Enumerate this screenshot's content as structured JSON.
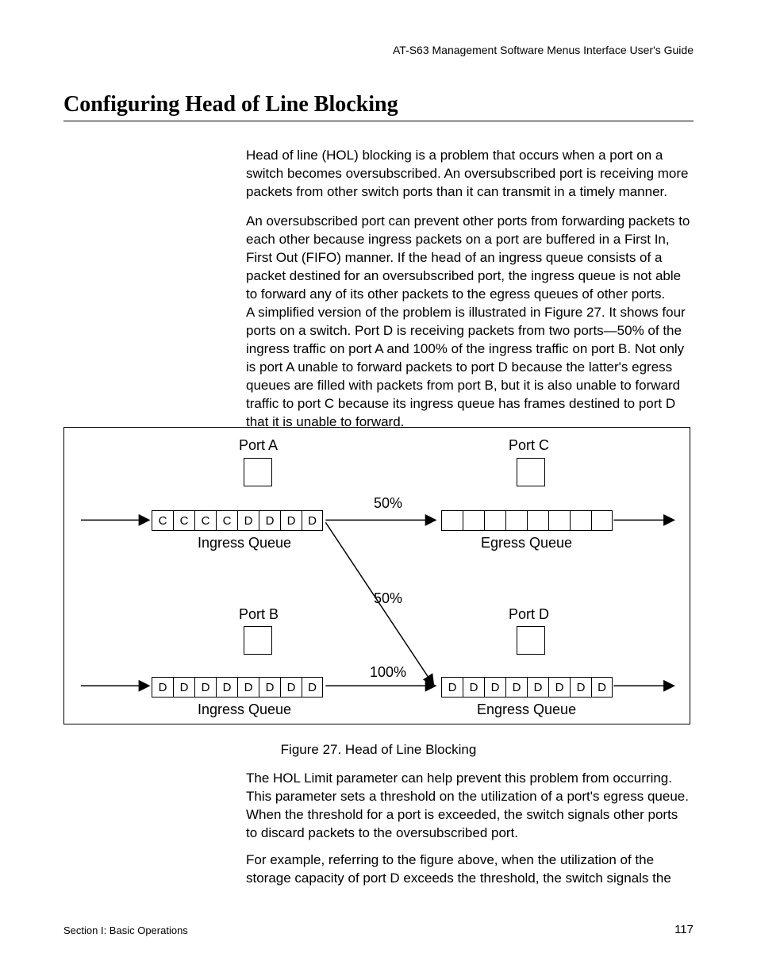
{
  "header": {
    "right": "AT-S63 Management Software Menus Interface User's Guide"
  },
  "title": "Configuring Head of Line Blocking",
  "paragraphs": {
    "p1": "Head of line (HOL) blocking is a problem that occurs when a port on a switch becomes oversubscribed. An oversubscribed port is receiving more packets from other switch ports than it can transmit in a timely manner.",
    "p2": "An oversubscribed port can prevent other ports from forwarding packets to each other because ingress packets on a port are buffered in a First In, First Out (FIFO) manner. If the head of an ingress queue consists of a packet destined for an oversubscribed port, the ingress queue is not able to forward any of its other packets to the egress queues of other ports.",
    "p3": "A simplified version of the problem is illustrated in Figure 27. It shows four ports on a switch. Port D is receiving packets from two ports—50% of the ingress traffic on port A and 100% of the ingress traffic on port B. Not only is port A unable to forward packets to port D because the latter's egress queues are filled with packets from port B, but it is also unable to forward traffic to port C because its ingress queue has frames destined to port D that it is unable to forward.",
    "p4": "The HOL Limit parameter can help prevent this problem from occurring. This parameter sets a threshold on the utilization of a port's egress queue. When the threshold for a port is exceeded, the switch signals other ports to discard packets to the oversubscribed port.",
    "p5": "For example, referring to the figure above, when the utilization of the storage capacity of port D exceeds the threshold, the switch signals the"
  },
  "figure": {
    "portA": "Port A",
    "portB": "Port B",
    "portC": "Port C",
    "portD": "Port D",
    "ingress": "Ingress Queue",
    "egress": "Egress Queue",
    "engress": "Engress Queue",
    "pct50": "50%",
    "pct100": "100%",
    "queueA": [
      "C",
      "C",
      "C",
      "C",
      "D",
      "D",
      "D",
      "D"
    ],
    "queueB": [
      "D",
      "D",
      "D",
      "D",
      "D",
      "D",
      "D",
      "D"
    ],
    "queueC": [
      "",
      "",
      "",
      "",
      "",
      "",
      "",
      ""
    ],
    "queueD": [
      "D",
      "D",
      "D",
      "D",
      "D",
      "D",
      "D",
      "D"
    ],
    "caption": "Figure 27. Head of Line Blocking"
  },
  "footer": {
    "left": "Section I: Basic Operations",
    "right": "117"
  }
}
